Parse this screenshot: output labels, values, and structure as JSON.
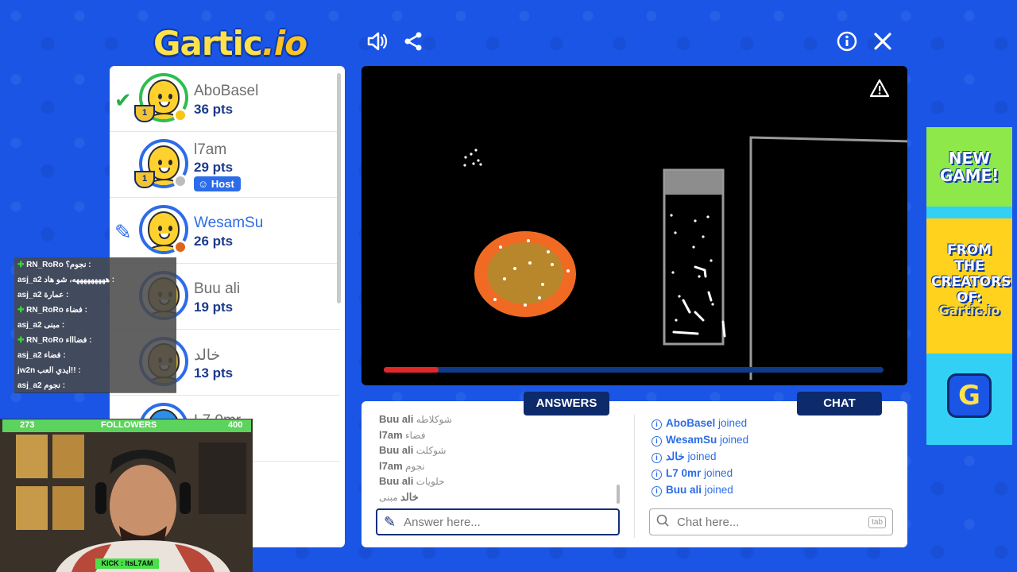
{
  "header": {
    "logo_main": "Gartic",
    "logo_suffix": ".io",
    "icons": [
      "sound-icon",
      "share-icon",
      "info-icon",
      "close-icon"
    ]
  },
  "players": [
    {
      "name": "AboBasel",
      "pts": "36 pts",
      "rank": "1",
      "status": "correct",
      "dot_color": "#f5c518"
    },
    {
      "name": "l7am",
      "pts": "29 pts",
      "rank": "1",
      "badge": "Host",
      "dot_color": "#bdbdbd"
    },
    {
      "name": "WesamSu",
      "pts": "26 pts",
      "status": "drawing",
      "dot_color": "#e06418"
    },
    {
      "name": "Buu ali",
      "pts": "19 pts"
    },
    {
      "name": "خالد",
      "pts": "13 pts"
    },
    {
      "name": "L7 0mr",
      "pts": ""
    }
  ],
  "overlay_chat": [
    {
      "user": "RN_RoRo",
      "text": "نجوم؟ :",
      "sub": true
    },
    {
      "user": "asj_a2",
      "text": "هههههههههه، شو هاد :"
    },
    {
      "user": "asj_a2",
      "text": "عمارة :"
    },
    {
      "user": "RN_RoRo",
      "text": "فضاء :",
      "sub": true
    },
    {
      "user": "asj_a2",
      "text": "مبنى :"
    },
    {
      "user": "RN_RoRo",
      "text": "فضاااء :",
      "sub": true
    },
    {
      "user": "asj_a2",
      "text": "فضاء :"
    },
    {
      "user": "jw2n",
      "text": "ايدي العب!! :"
    },
    {
      "user": "asj_a2",
      "text": "نجوم :"
    }
  ],
  "stream": {
    "count_left": "273",
    "followers_label": "FOLLOWERS",
    "count_right": "400",
    "kick_label": "KICK : ItsL7AM"
  },
  "tabs": {
    "answers": "ANSWERS",
    "chat": "CHAT"
  },
  "answers": [
    {
      "user": "Buu ali",
      "text": "شوكلاطه"
    },
    {
      "user": "l7am",
      "text": "فضاء"
    },
    {
      "user": "Buu ali",
      "text": "شوكلت"
    },
    {
      "user": "l7am",
      "text": "نجوم"
    },
    {
      "user": "Buu ali",
      "text": "حلويات"
    },
    {
      "user": "خالد",
      "text": "مبنى"
    }
  ],
  "chat_log": [
    {
      "user": "AboBasel",
      "text": "joined"
    },
    {
      "user": "WesamSu",
      "text": "joined"
    },
    {
      "user": "خالد",
      "text": "joined"
    },
    {
      "user": "L7 0mr",
      "text": "joined"
    },
    {
      "user": "Buu ali",
      "text": "joined"
    }
  ],
  "inputs": {
    "answer_placeholder": "Answer here...",
    "chat_placeholder": "Chat here...",
    "chat_key_hint": "tab"
  },
  "progress": {
    "fraction": 0.11
  },
  "ad": {
    "line1": "NEW GAME!",
    "line2": "FROM THE CREATORS OF:",
    "brand": "Gartic.io",
    "icon_letter": "G"
  }
}
